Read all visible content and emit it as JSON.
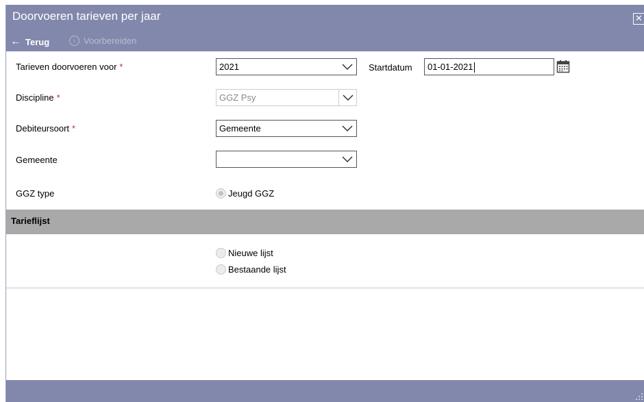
{
  "dialog": {
    "title": "Doorvoeren tarieven per jaar",
    "close_icon": "close-box-icon"
  },
  "toolbar": {
    "back_label": "Terug",
    "back_icon": "arrow-left-icon",
    "prepare_label": "Voorbereiden",
    "prepare_icon": "circle-chevron-right-icon"
  },
  "form": {
    "required_marker": "*",
    "year": {
      "label": "Tarieven doorvoeren voor",
      "value": "2021"
    },
    "startdate": {
      "label": "Startdatum",
      "value": "01-01-2021",
      "icon": "calendar-icon"
    },
    "discipline": {
      "label": "Discipline",
      "value": "GGZ Psy",
      "disabled": true
    },
    "debtor_type": {
      "label": "Debiteursoort",
      "value": "Gemeente"
    },
    "municipality": {
      "label": "Gemeente",
      "value": ""
    },
    "ggz_type": {
      "label": "GGZ type",
      "option": "Jeugd GGZ",
      "selected": true,
      "disabled": true
    }
  },
  "tariff_list": {
    "title": "Tarieflijst",
    "options": [
      "Nieuwe lijst",
      "Bestaande lijst"
    ]
  },
  "colors": {
    "titlebar": "#8288ac",
    "section_header": "#a9a9a9",
    "required": "#cc2a2a"
  }
}
